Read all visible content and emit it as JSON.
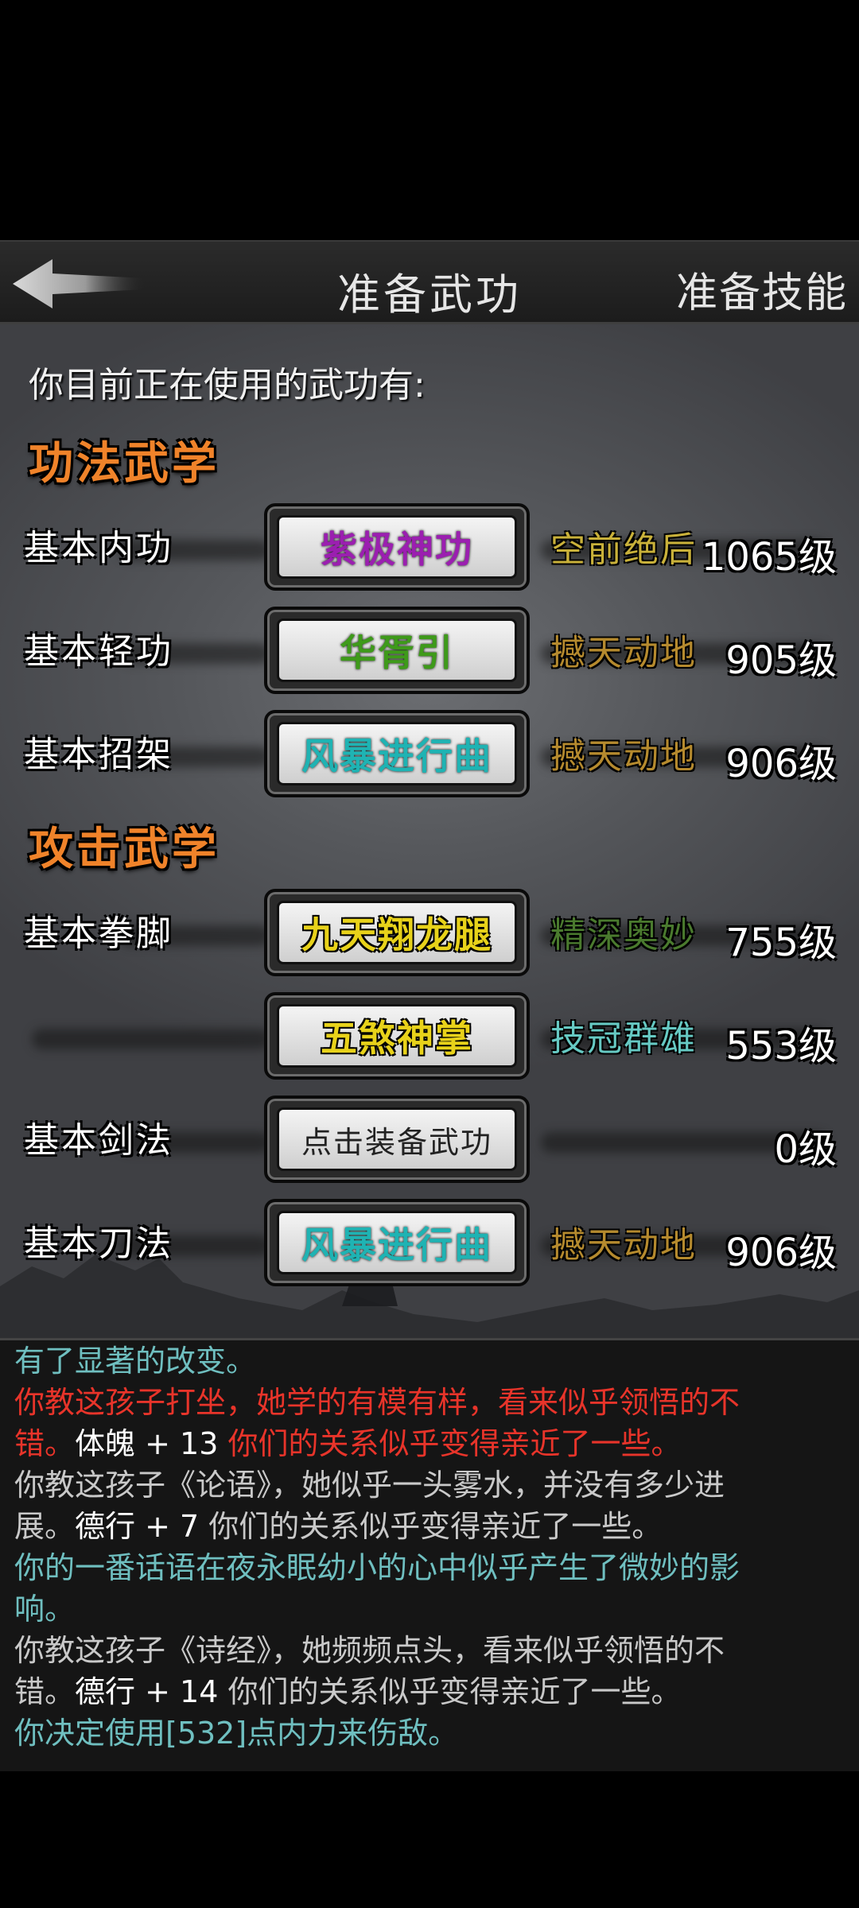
{
  "header": {
    "title": "准备武功",
    "right_button": "准备技能"
  },
  "intro": "你目前正在使用的武功有:",
  "sections": [
    {
      "title": "功法武学"
    },
    {
      "title": "攻击武学"
    }
  ],
  "rows": [
    {
      "label": "基本内功",
      "skill": "紫极神功",
      "rank": "空前绝后",
      "level": "1065级"
    },
    {
      "label": "基本轻功",
      "skill": "华胥引",
      "rank": "撼天动地",
      "level": "905级"
    },
    {
      "label": "基本招架",
      "skill": "风暴进行曲",
      "rank": "撼天动地",
      "level": "906级"
    },
    {
      "label": "基本拳脚",
      "skill": "九天翔龙腿",
      "rank": "精深奥妙",
      "level": "755级"
    },
    {
      "label": "",
      "skill": "五煞神掌",
      "rank": "技冠群雄",
      "level": "553级"
    },
    {
      "label": "基本剑法",
      "skill": "点击装备武功",
      "rank": "",
      "level": "0级"
    },
    {
      "label": "基本刀法",
      "skill": "风暴进行曲",
      "rank": "撼天动地",
      "level": "906级"
    }
  ],
  "colors": {
    "skill_purple": "#9b1fb0",
    "skill_green": "#3e9a1a",
    "skill_cyan": "#1fb3b3",
    "skill_yellow": "#e8d21a",
    "rank_gold": "#c9b13a",
    "rank_brown": "#b58a2e",
    "rank_green": "#4a7a2e",
    "rank_teal": "#66c9c3",
    "log_red": "#e8342a",
    "log_teal": "#6fbfc0",
    "log_gray": "#c9c9c9"
  },
  "log": {
    "lines": [
      {
        "parts": [
          {
            "text": "有了显著的改变。",
            "color": "#6fbfc0"
          }
        ]
      },
      {
        "parts": [
          {
            "text": "你教这孩子打坐，她学的有模有样，看来似乎领悟的不",
            "color": "#e8342a"
          }
        ]
      },
      {
        "parts": [
          {
            "text": "错。",
            "color": "#e8342a"
          },
          {
            "text": "体魄 + 13 ",
            "color": "#ffffff"
          },
          {
            "text": "你们的关系似乎变得亲近了一些。",
            "color": "#e8342a"
          }
        ]
      },
      {
        "parts": [
          {
            "text": "你教这孩子《论语》，她似乎一头雾水，并没有多少进",
            "color": "#c9c9c9"
          }
        ]
      },
      {
        "parts": [
          {
            "text": "展。",
            "color": "#c9c9c9"
          },
          {
            "text": "德行 + 7 ",
            "color": "#ffffff"
          },
          {
            "text": "你们的关系似乎变得亲近了一些。",
            "color": "#c9c9c9"
          }
        ]
      },
      {
        "parts": [
          {
            "text": "你的一番话语在夜永眠幼小的心中似乎产生了微妙的影",
            "color": "#6fbfc0"
          }
        ]
      },
      {
        "parts": [
          {
            "text": "响。",
            "color": "#6fbfc0"
          }
        ]
      },
      {
        "parts": [
          {
            "text": "你教这孩子《诗经》，她频频点头，看来似乎领悟的不",
            "color": "#c9c9c9"
          }
        ]
      },
      {
        "parts": [
          {
            "text": "错。",
            "color": "#c9c9c9"
          },
          {
            "text": "德行 + 14 ",
            "color": "#ffffff"
          },
          {
            "text": "你们的关系似乎变得亲近了一些。",
            "color": "#c9c9c9"
          }
        ]
      },
      {
        "parts": [
          {
            "text": "你决定使用[532]点内力来伤敌。",
            "color": "#6fbfc0"
          }
        ]
      }
    ]
  }
}
